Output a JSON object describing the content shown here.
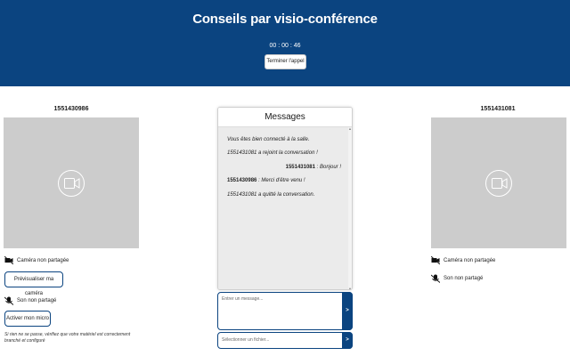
{
  "header": {
    "title": "Conseils par visio-conférence",
    "timer": "00 : 00 : 46",
    "end_call_label": "Terminer l'appel",
    "background": "#0b4480"
  },
  "left_panel": {
    "participant_id": "1551430986",
    "camera_status": "Caméra non partagée",
    "preview_camera_label": "Prévisualiser ma caméra",
    "sound_status": "Son non partagé",
    "activate_mic_label": "Activer mon micro",
    "hint": "Si rien ne se passe, vérifiez que votre matériel est correctement branché et configuré"
  },
  "chat": {
    "title": "Messages",
    "messages": [
      {
        "text": "Vous êtes bien connecté à la salle."
      },
      {
        "text": "1551431081 a rejoint la conversation !"
      },
      {
        "sender": "1551431081",
        "text": " : Bonjour !"
      },
      {
        "sender": "1551430986",
        "text": " : Merci d'être venu !"
      },
      {
        "text": "1551431081 a quitté la conversation."
      }
    ],
    "input_placeholder": "Entrer un message...",
    "send_label": ">",
    "file_placeholder": "Sélectionner un fichier...",
    "file_send_label": ">"
  },
  "right_panel": {
    "participant_id": "1551431081",
    "camera_status": "Caméra non partagée",
    "sound_status": "Son non partagé"
  },
  "icons": {
    "video_placeholder": "video-camera-icon",
    "camera_off": "camera-off-icon",
    "sound_off": "microphone-off-icon"
  }
}
